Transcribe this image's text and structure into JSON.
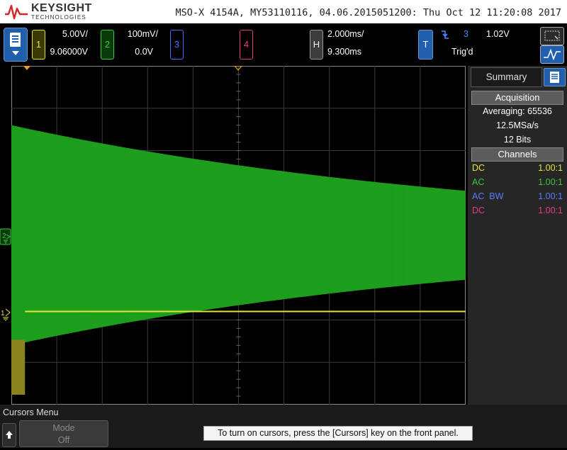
{
  "brand": {
    "name": "KEYSIGHT",
    "subtitle": "TECHNOLOGIES"
  },
  "instrument_info": "MSO-X 4154A, MY53110116, 04.06.2015051200: Thu Oct 12 11:20:08 2017",
  "channels": [
    {
      "number": "1",
      "scale": "5.00V/",
      "offset": "9.06000V",
      "color": "#e6e23c",
      "active": true
    },
    {
      "number": "2",
      "scale": "100mV/",
      "offset": "0.0V",
      "color": "#3cc83c",
      "active": true
    },
    {
      "number": "3",
      "color": "#4a6cff",
      "active": false
    },
    {
      "number": "4",
      "color": "#e23c8c",
      "active": false
    }
  ],
  "horizontal": {
    "label": "H",
    "scale": "2.000ms/",
    "delay": "9.300ms"
  },
  "trigger": {
    "label": "T",
    "slope_icon": "falling-edge-icon",
    "source": "3",
    "level": "1.02V",
    "status": "Trig'd"
  },
  "waveform": {
    "ch2_burst": {
      "shape": "decaying sinusoid envelope",
      "amplitude_start_div": 2.6,
      "amplitude_end_div": 1.05,
      "center_div": 0.0,
      "start_time_div": 0.0,
      "color": "#1ea01e"
    },
    "ch1_level_div": -1.8,
    "ch1_pulse_end_time_div": 0.3
  },
  "summary_panel": {
    "tab_label": "Summary",
    "acquisition_header": "Acquisition",
    "acquisition_lines": [
      "Averaging: 65536",
      "12.5MSa/s",
      "12 Bits"
    ],
    "channels_header": "Channels",
    "channel_rows": [
      {
        "coupling": "DC",
        "ratio": "1.00:1",
        "color": "#e6e23c"
      },
      {
        "coupling": "AC",
        "ratio": "1.00:1",
        "color": "#3cc83c"
      },
      {
        "coupling": "AC  BW",
        "ratio": "1.00:1",
        "color": "#5a7cff"
      },
      {
        "coupling": "DC",
        "ratio": "1.00:1",
        "color": "#e23c8c"
      }
    ]
  },
  "softkeys": {
    "menu_title": "Cursors Menu",
    "mode_label": "Mode",
    "mode_value": "Off",
    "message": "To turn on cursors, press the [Cursors] key on the front panel."
  }
}
